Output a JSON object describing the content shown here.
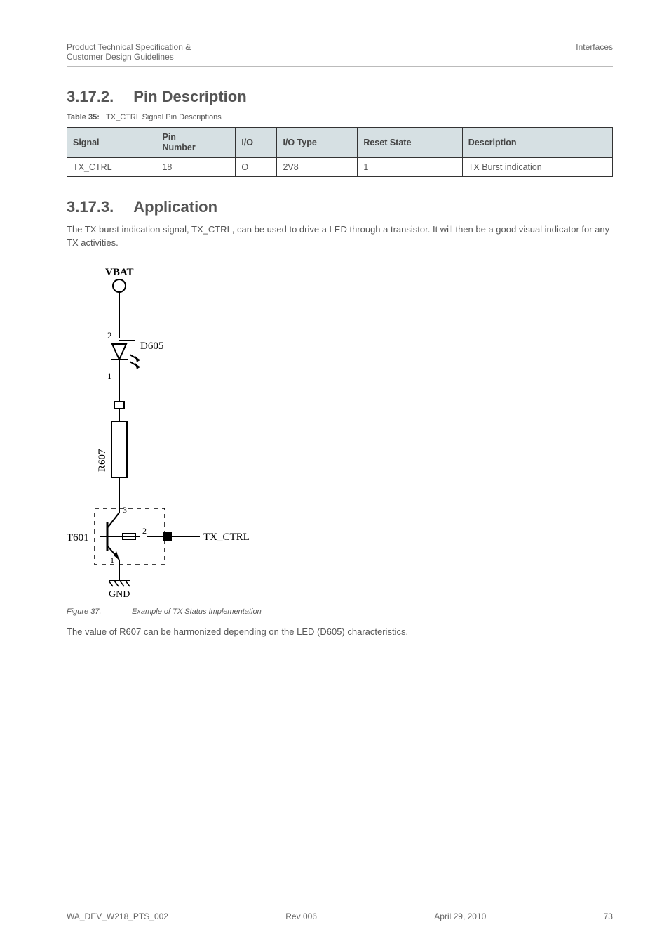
{
  "header": {
    "left_line1": "Product Technical Specification &",
    "left_line2": "Customer Design Guidelines",
    "right": "Interfaces"
  },
  "sections": {
    "pin_description": {
      "number": "3.17.2.",
      "title": "Pin Description"
    },
    "application": {
      "number": "3.17.3.",
      "title": "Application"
    }
  },
  "table35": {
    "caption_label": "Table 35:",
    "caption_text": "TX_CTRL Signal Pin Descriptions",
    "headers": {
      "signal": "Signal",
      "pin_number_l1": "Pin",
      "pin_number_l2": "Number",
      "io": "I/O",
      "io_type": "I/O Type",
      "reset_state": "Reset State",
      "description": "Description"
    },
    "row": {
      "signal": "TX_CTRL",
      "pin_number": "18",
      "io": "O",
      "io_type": "2V8",
      "reset_state": "1",
      "description": "TX Burst indication"
    }
  },
  "application_paragraph": "The TX burst indication signal, TX_CTRL, can be used to drive a LED through a transistor.  It will then be a good visual indicator for any TX activities.",
  "figure37": {
    "label": "Figure 37.",
    "caption": "Example of TX Status Implementation",
    "labels": {
      "vbat": "VBAT",
      "d605": "D605",
      "r607": "R607",
      "tx_ctrl": "TX_CTRL",
      "t601": "T601",
      "gnd": "GND",
      "n1": "1",
      "n2": "2",
      "n3_top": "3",
      "n2_mid": "2",
      "n1_bot": "1"
    }
  },
  "post_figure_paragraph": "The value of R607 can be harmonized depending on the LED (D605) characteristics.",
  "footer": {
    "doc_id": "WA_DEV_W218_PTS_002",
    "rev": "Rev 006",
    "date": "April 29, 2010",
    "page": "73"
  }
}
